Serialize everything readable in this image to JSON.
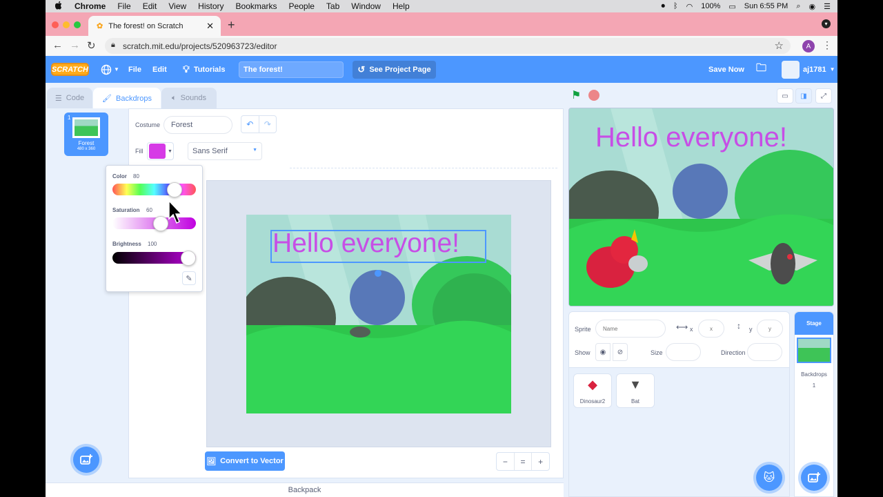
{
  "mac_menu": {
    "apple": "",
    "app": "Chrome",
    "items": [
      "File",
      "Edit",
      "View",
      "History",
      "Bookmarks",
      "People",
      "Tab",
      "Window",
      "Help"
    ],
    "battery": "100%",
    "clock": "Sun 6:55 PM"
  },
  "browser": {
    "tab_title": "The forest! on Scratch",
    "url": "scratch.mit.edu/projects/520963723/editor",
    "profile_initial": "A"
  },
  "scratch_header": {
    "logo": "SCRATCH",
    "file": "File",
    "edit": "Edit",
    "tutorials": "Tutorials",
    "project_title": "The forest!",
    "see_project": "See Project Page",
    "save_now": "Save Now",
    "username": "aj1781"
  },
  "tabs": {
    "code": "Code",
    "backdrops": "Backdrops",
    "sounds": "Sounds"
  },
  "costume_list": [
    {
      "index": "1",
      "name": "Forest",
      "size": "480 x 360"
    }
  ],
  "paint_editor": {
    "costume_label": "Costume",
    "costume_name": "Forest",
    "fill_label": "Fill",
    "fill_color": "#d63ae6",
    "font": "Sans Serif",
    "canvas_text": "Hello everyone!",
    "convert_button": "Convert to Vector",
    "zoom_out": "−",
    "zoom_reset": "=",
    "zoom_in": "+"
  },
  "color_popover": {
    "color_label": "Color",
    "color_value": "80",
    "saturation_label": "Saturation",
    "saturation_value": "60",
    "brightness_label": "Brightness",
    "brightness_value": "100"
  },
  "stage": {
    "text": "Hello everyone!"
  },
  "sprite_info": {
    "sprite_label": "Sprite",
    "name_placeholder": "Name",
    "x_label": "x",
    "x_placeholder": "x",
    "y_label": "y",
    "y_placeholder": "y",
    "show_label": "Show",
    "size_label": "Size",
    "direction_label": "Direction"
  },
  "sprites": [
    {
      "name": "Dinosaur2"
    },
    {
      "name": "Bat"
    }
  ],
  "stage_panel": {
    "title": "Stage",
    "backdrops_label": "Backdrops",
    "backdrops_count": "1"
  },
  "backpack": "Backpack",
  "colors": {
    "scratch_blue": "#4c97ff",
    "tab_bar": "#f4a6b4",
    "fill_magenta": "#d63ae6"
  }
}
